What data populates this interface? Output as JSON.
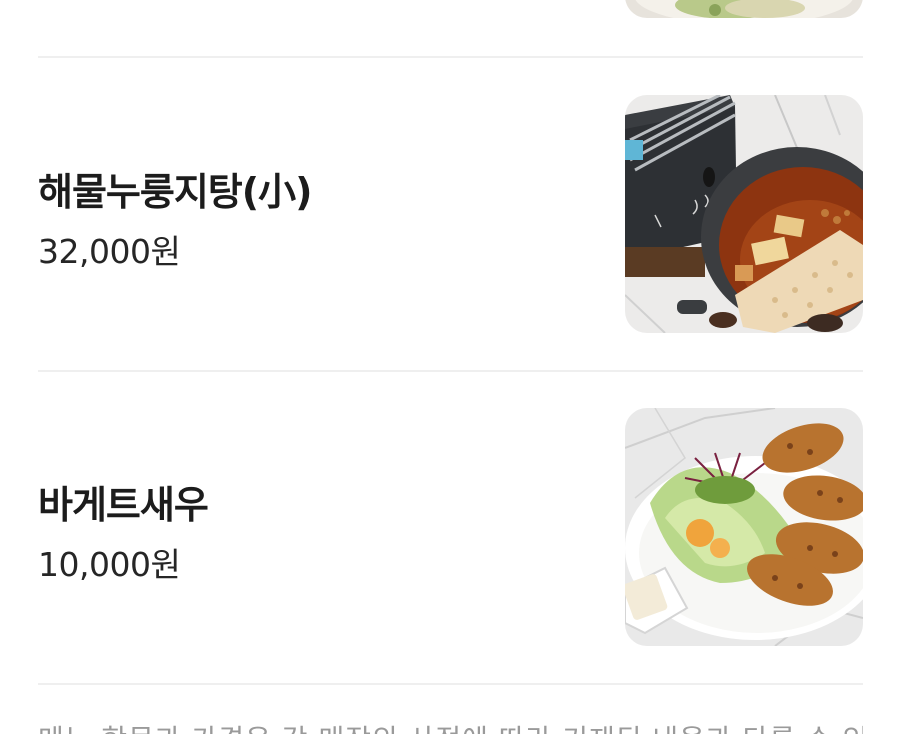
{
  "menu": {
    "items": [
      {
        "name": "해물누룽지탕(小)",
        "price": "32,000원",
        "image_icon": "seafood-nurungji-stew-photo"
      },
      {
        "name": "바게트새우",
        "price": "10,000원",
        "image_icon": "baguette-shrimp-photo"
      }
    ]
  },
  "notice": {
    "text": "메뉴 항목과 가격은 각 매장의 사정에 따라 기재된 내용과 다를 수 있"
  },
  "colors": {
    "divider": "#efefef",
    "text_primary": "#1c1c1c",
    "text_muted": "#9a9a9a"
  }
}
